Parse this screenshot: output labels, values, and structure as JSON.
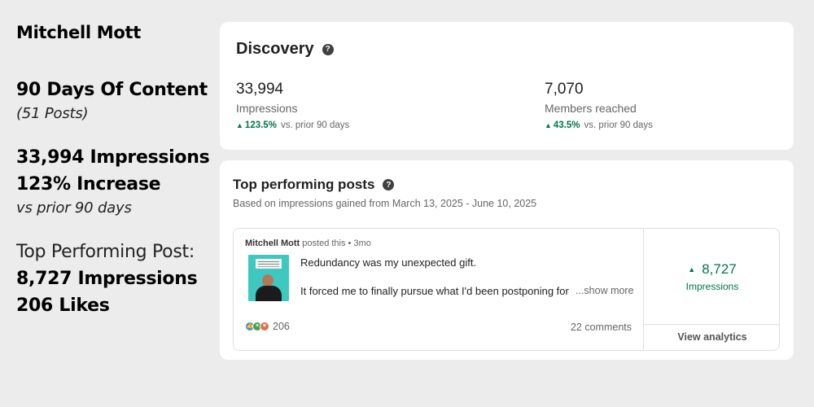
{
  "summary": {
    "name": "Mitchell Mott",
    "content_title": "90 Days Of Content",
    "posts_count": "(51 Posts)",
    "impressions": "33,994 Impressions",
    "increase": "123% Increase",
    "vs_prior": "vs prior 90 days",
    "top_post_heading": "Top Performing Post:",
    "top_post_impressions": "8,727 Impressions",
    "top_post_likes": "206 Likes"
  },
  "discovery": {
    "title": "Discovery",
    "help_icon": "question-circle-icon",
    "metrics": [
      {
        "value": "33,994",
        "label": "Impressions",
        "change": "123.5%",
        "change_suffix": "vs. prior 90 days"
      },
      {
        "value": "7,070",
        "label": "Members reached",
        "change": "43.5%",
        "change_suffix": "vs. prior 90 days"
      }
    ]
  },
  "top_posts": {
    "title": "Top performing posts",
    "subtitle": "Based on impressions gained from March 13, 2025 - June 10, 2025",
    "post": {
      "author": "Mitchell Mott",
      "meta_suffix": "posted this • 3mo",
      "line1": "Redundancy was my unexpected gift.",
      "line2": "It forced me to finally pursue what I'd been postponing for y",
      "show_more": "...show more",
      "reaction_count": "206",
      "comments": "22 comments",
      "impressions_value": "8,727",
      "impressions_label": "Impressions",
      "view_analytics": "View analytics"
    }
  },
  "colors": {
    "positive": "#01754f",
    "background": "#ececec",
    "card": "#ffffff"
  }
}
